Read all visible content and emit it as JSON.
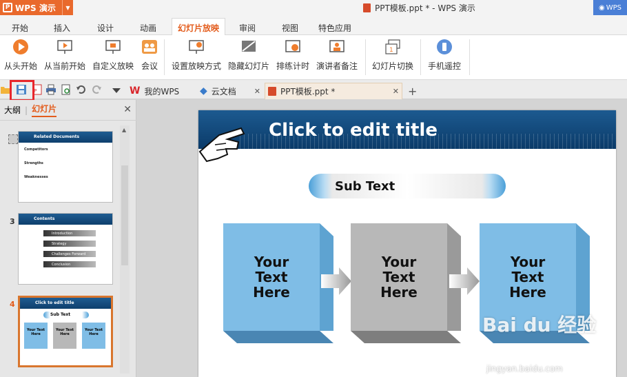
{
  "app": {
    "menu_button": "WPS 演示",
    "document_title": "PPT模板.ppt * - WPS 演示",
    "account": "WPS"
  },
  "menu": [
    "开始",
    "插入",
    "设计",
    "动画",
    "幻灯片放映",
    "审阅",
    "视图",
    "特色应用"
  ],
  "ribbon": {
    "from_start": "从头开始",
    "from_current": "从当前开始",
    "custom_show": "自定义放映",
    "meeting": "会议",
    "setup_show": "设置放映方式",
    "hide_slide": "隐藏幻灯片",
    "rehearse": "排练计时",
    "presenter_notes": "演讲者备注",
    "slide_transition": "幻灯片切换",
    "phone_remote": "手机遥控"
  },
  "tabs": [
    {
      "label": "我的WPS"
    },
    {
      "label": "云文档"
    },
    {
      "label": "PPT模板.ppt *"
    }
  ],
  "left_panel": {
    "outline": "大纲",
    "slides": "幻灯片",
    "thumb2": {
      "title": "Related Documents",
      "items": [
        "Competitors",
        "Strengths",
        "Weaknesses"
      ]
    },
    "thumb3": {
      "number": "3",
      "title": "Contents",
      "items": [
        "Introduction",
        "Strategy",
        "Challenges Forward",
        "Conclusion"
      ]
    },
    "thumb4": {
      "number": "4",
      "title": "Click to edit title",
      "sub": "Sub Text",
      "box": "Your Text Here"
    }
  },
  "slide": {
    "title": "Click to edit title",
    "subtext": "Sub Text",
    "boxes": [
      {
        "l1": "Your",
        "l2": "Text",
        "l3": "Here",
        "color": "#7fbde6"
      },
      {
        "l1": "Your",
        "l2": "Text",
        "l3": "Here",
        "color": "#b8b8b8"
      },
      {
        "l1": "Your",
        "l2": "Text",
        "l3": "Here",
        "color": "#7fbde6"
      }
    ]
  },
  "watermark": {
    "logo": "Bai du 经验",
    "url": "jingyan.baidu.com"
  }
}
